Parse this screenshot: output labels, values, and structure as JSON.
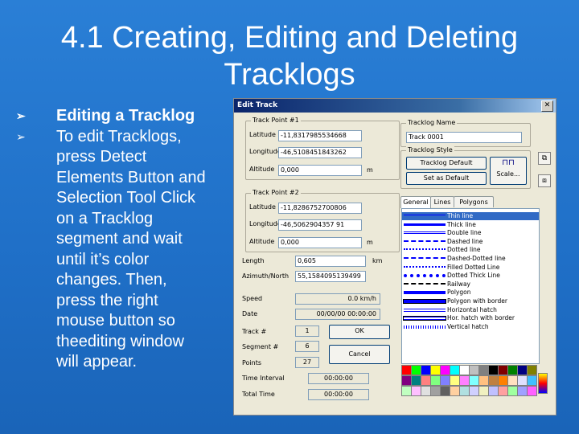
{
  "slide": {
    "title_line1": "4.1 Creating, Editing and Deleting",
    "title_line2": "Tracklogs",
    "bullet1": "Editing a Tracklog",
    "bullet2_lines": [
      "To edit Tracklogs,",
      "press Detect",
      "Elements Button and",
      "Selection Tool Click",
      "on a Tracklog",
      "segment and wait",
      "until it’s color",
      "changes. Then,",
      "press the right",
      "mouse button so",
      "theediting window",
      "will appear."
    ]
  },
  "dialog": {
    "title": "Edit Track",
    "close_glyph": "✕",
    "tp1": {
      "label": "Track Point #1",
      "lat_label": "Latitude",
      "lat": "-11,8317985534668",
      "lon_label": "Longitude",
      "lon": "-46,5108451843262",
      "alt_label": "Altitude",
      "alt": "0,000",
      "alt_unit": "m"
    },
    "tp2": {
      "label": "Track Point #2",
      "lat_label": "Latitude",
      "lat": "-11,8286752700806",
      "lon_label": "Longitude",
      "lon": "-46,5062904357 91",
      "alt_label": "Altitude",
      "alt": "0,000",
      "alt_unit": "m"
    },
    "length_label": "Length",
    "length": "0,605",
    "length_unit": "km",
    "azimuth_label": "Azimuth/North",
    "azimuth": "55,1584095139499",
    "speed_label": "Speed",
    "speed": "0.0 km/h",
    "date_label": "Date",
    "date": "00/00/00 00:00:00",
    "track_label": "Track #",
    "track": "1",
    "segment_label": "Segment #",
    "segment": "6",
    "points_label": "Points",
    "points": "27",
    "time_interval_label": "Time Interval",
    "time_interval": "00:00:00",
    "total_time_label": "Total Time",
    "total_time": "00:00:00",
    "ok": "OK",
    "cancel": "Cancel",
    "name_group": "Tracklog Name",
    "name": "Track 0001",
    "style_group": "Tracklog Style",
    "tracklog_default": "Tracklog Default",
    "set_as_default": "Set as Default",
    "scale": "Scale...",
    "tabs": [
      "General",
      "Lines",
      "Polygons"
    ],
    "styles": [
      "Thin line",
      "Thick line",
      "Double line",
      "Dashed line",
      "Dotted line",
      "Dashed-Dotted line",
      "Filled Dotted Line",
      "Dotted Thick Line",
      "Railway",
      "Polygon",
      "Polygon with border",
      "Horizontal hatch",
      "Hor. hatch with border",
      "Vertical hatch"
    ],
    "colors": {
      "selected": "#316ac5",
      "line": "#0000ff",
      "titlebar": "#0a246a"
    },
    "palette": [
      "#ff0000",
      "#00ff00",
      "#0000ff",
      "#ffff00",
      "#ff00ff",
      "#00ffff",
      "#ffffff",
      "#c0c0c0",
      "#808080",
      "#000000",
      "#800000",
      "#008000",
      "#000080",
      "#808000",
      "#800080",
      "#008080",
      "#ff8080",
      "#80ff80",
      "#8080ff",
      "#ffff80",
      "#ff80ff",
      "#80ffff",
      "#ffc080",
      "#c08040",
      "#ff8000",
      "#ffe0c0",
      "#e0e0ff",
      "#40c0ff",
      "#c0ffc0",
      "#ffc0ff",
      "#e0e0e0",
      "#a0a0a0",
      "#606060",
      "#ffd0a0",
      "#b0e0e0",
      "#d0d0ff",
      "#f0f0c0",
      "#c0c0ff",
      "#ffa0a0",
      "#a0ffa0",
      "#a0a0ff",
      "#ff60ff"
    ]
  }
}
